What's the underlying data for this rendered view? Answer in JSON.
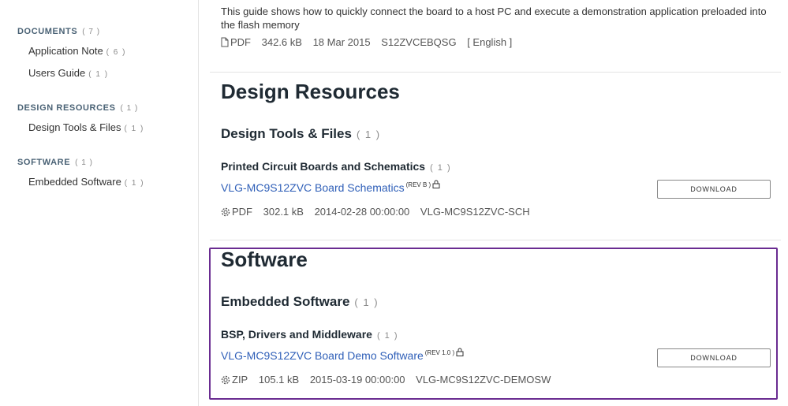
{
  "sidebar": {
    "categories": [
      {
        "label": "DOCUMENTS",
        "count": "( 7 )",
        "items": [
          {
            "label": "Application Note",
            "count": "( 6 )"
          },
          {
            "label": "Users Guide",
            "count": "( 1 )"
          }
        ]
      },
      {
        "label": "DESIGN RESOURCES",
        "count": "( 1 )",
        "items": [
          {
            "label": "Design Tools & Files",
            "count": "( 1 )"
          }
        ]
      },
      {
        "label": "SOFTWARE",
        "count": "( 1 )",
        "items": [
          {
            "label": "Embedded Software",
            "count": "( 1 )"
          }
        ]
      }
    ]
  },
  "top_doc": {
    "description": "This guide shows how to quickly connect the board to a host PC and execute a demonstration application preloaded into the flash memory",
    "type": "PDF",
    "size": "342.6 kB",
    "date": "18 Mar 2015",
    "id": "S12ZVCEBQSG",
    "language": "[ English ]"
  },
  "design_resources": {
    "title": "Design Resources",
    "subtitle": "Design Tools & Files",
    "subtitle_count": "( 1 )",
    "group": "Printed Circuit Boards and Schematics",
    "group_count": "( 1 )",
    "item": {
      "title": "VLG-MC9S12ZVC Board Schematics",
      "rev": "(REV B )",
      "type": "PDF",
      "size": "302.1 kB",
      "date": "2014-02-28 00:00:00",
      "id": "VLG-MC9S12ZVC-SCH",
      "button": "DOWNLOAD"
    }
  },
  "software": {
    "title": "Software",
    "subtitle": "Embedded Software",
    "subtitle_count": "( 1 )",
    "group": "BSP, Drivers and Middleware",
    "group_count": "( 1 )",
    "item": {
      "title": "VLG-MC9S12ZVC Board Demo Software",
      "rev": "(REV 1.0 )",
      "type": "ZIP",
      "size": "105.1 kB",
      "date": "2015-03-19 00:00:00",
      "id": "VLG-MC9S12ZVC-DEMOSW",
      "button": "DOWNLOAD"
    }
  },
  "icons": {
    "document": "document-icon",
    "gear": "gear-icon",
    "lock": "lock-icon"
  },
  "colors": {
    "link": "#2f5fb8",
    "highlight": "#6a2c91",
    "category": "#4a6275"
  }
}
